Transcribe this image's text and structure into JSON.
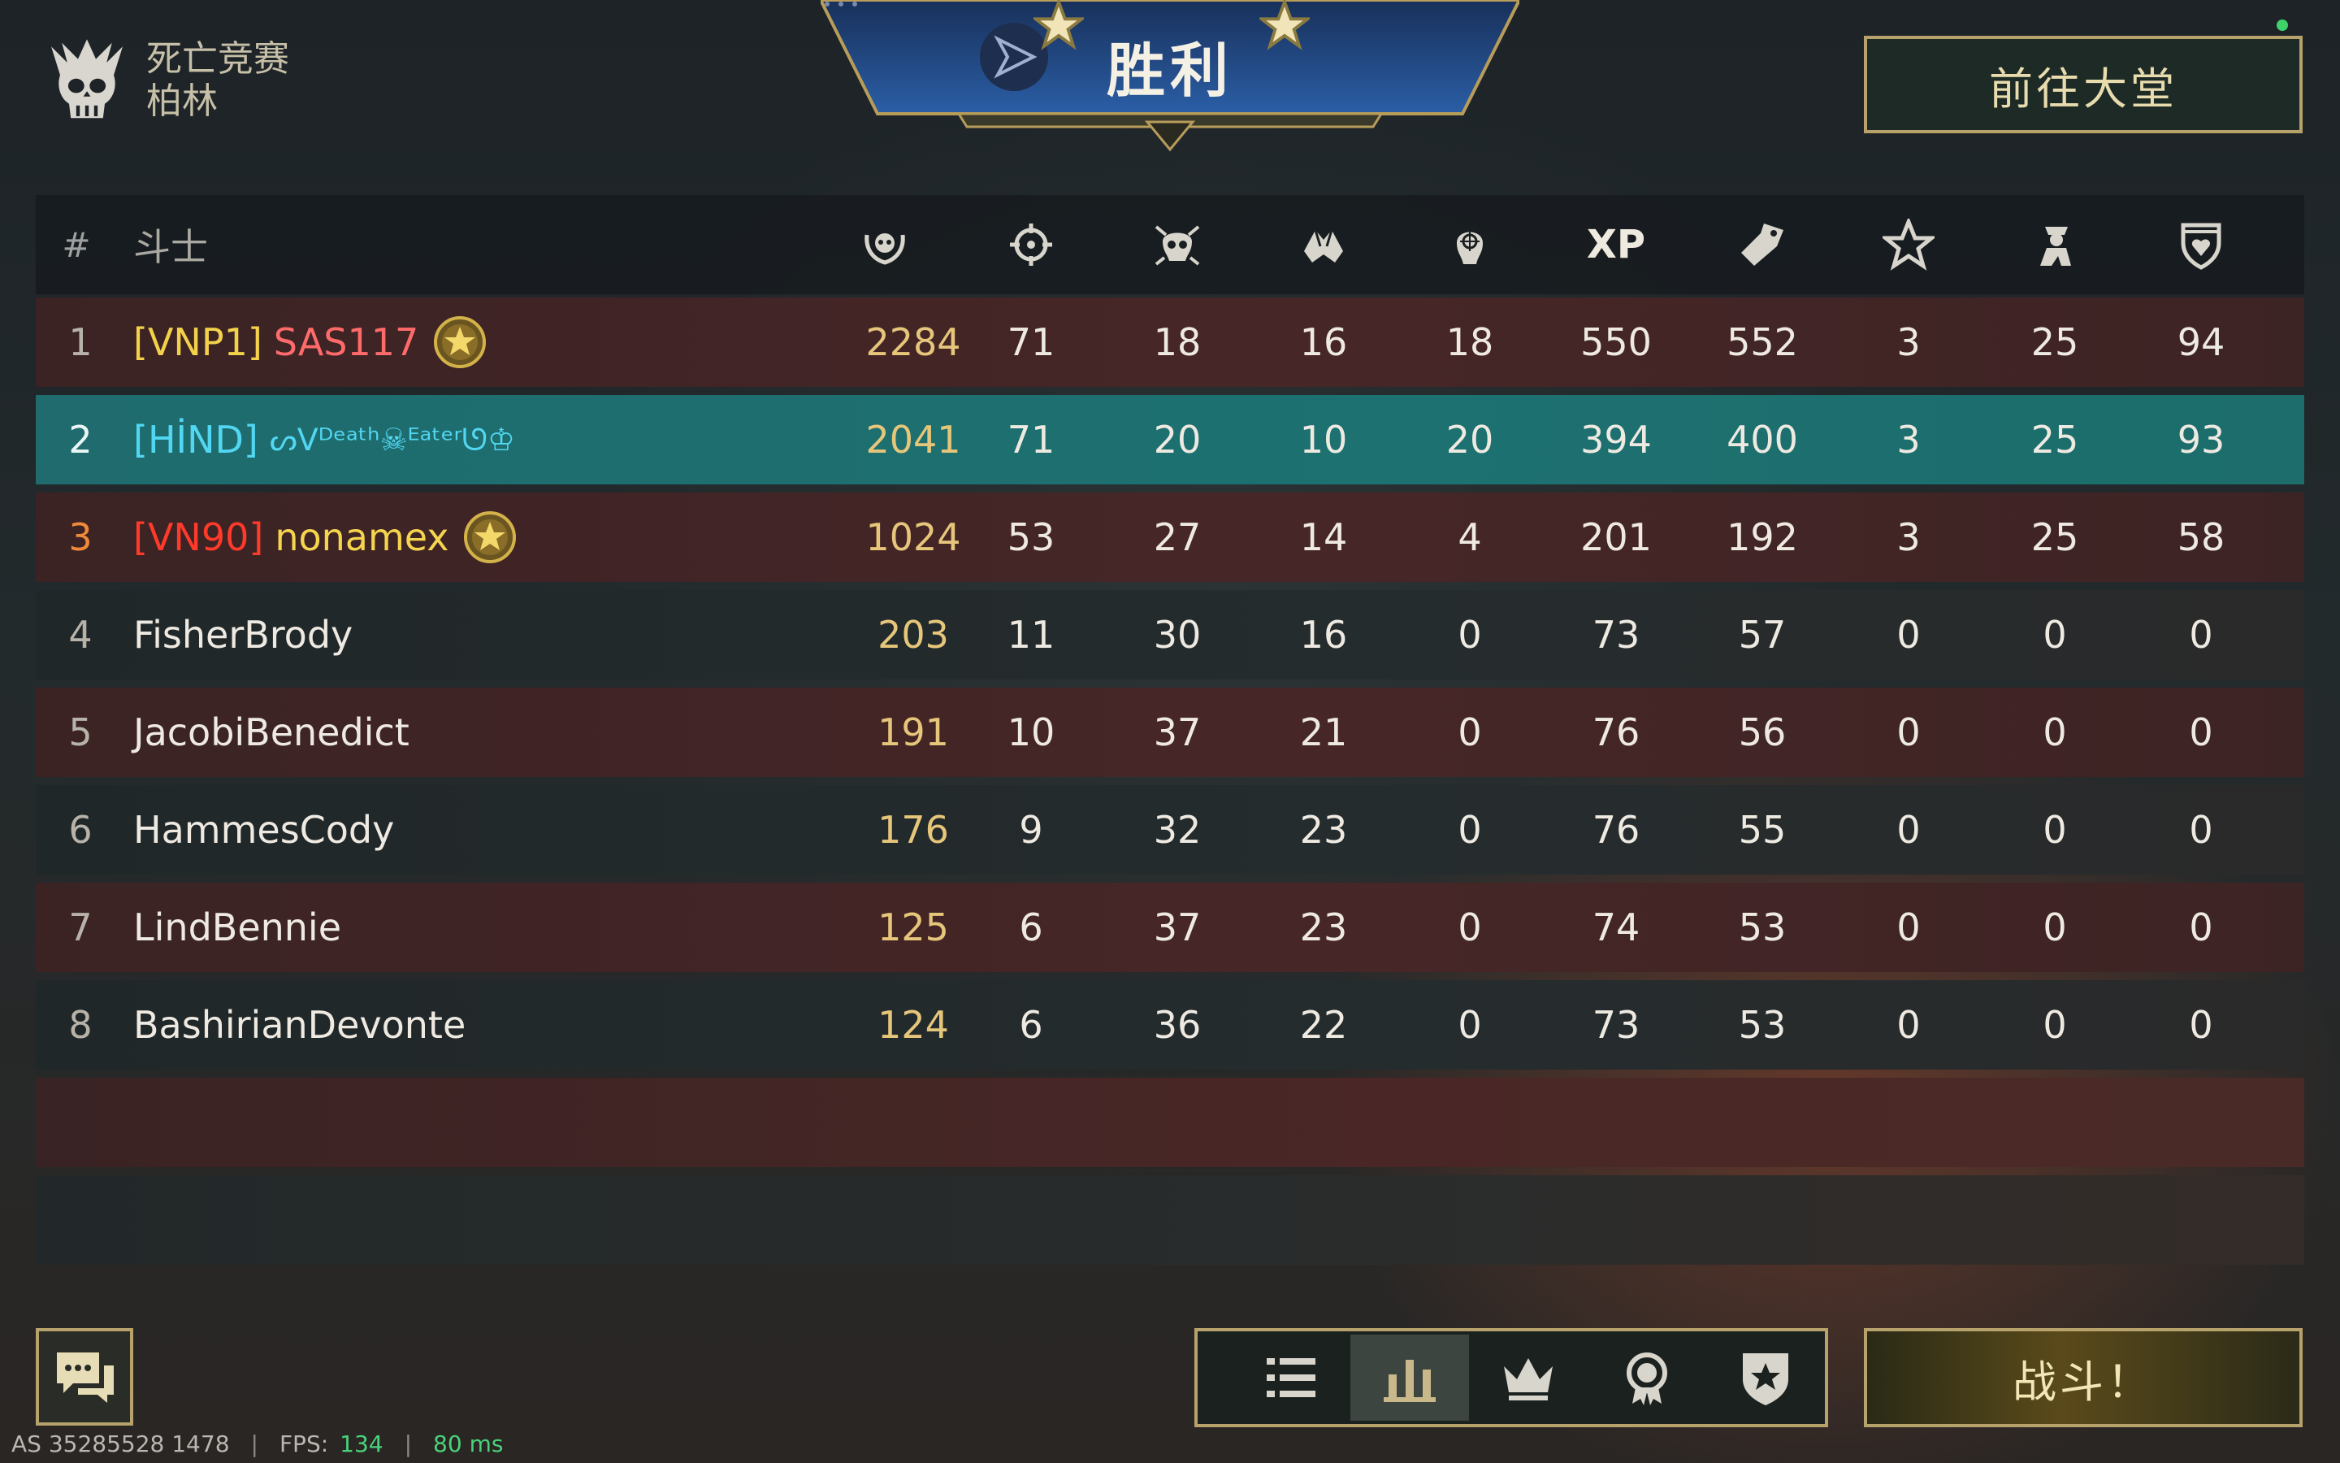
{
  "mode": {
    "name": "死亡竞赛",
    "map": "柏林"
  },
  "banner": {
    "title": "胜利"
  },
  "buttons": {
    "lobby": "前往大堂",
    "fight": "战斗！"
  },
  "table": {
    "rank_header": "#",
    "name_header": "斗士",
    "columns": [
      {
        "icon": "score-wreath-icon"
      },
      {
        "icon": "crosshair-icon"
      },
      {
        "icon": "deaths-skull-icon"
      },
      {
        "icon": "assists-hands-icon"
      },
      {
        "icon": "headshot-icon"
      },
      {
        "label": "XP"
      },
      {
        "icon": "tag-icon"
      },
      {
        "icon": "star-icon"
      },
      {
        "icon": "soldier-icon"
      },
      {
        "icon": "shield-heart-icon"
      }
    ],
    "rows": [
      {
        "rank": "1",
        "clan": "[VNP1]",
        "name": "SAS117",
        "medal": true,
        "stats": [
          "2284",
          "71",
          "18",
          "16",
          "18",
          "550",
          "552",
          "3",
          "25",
          "94"
        ]
      },
      {
        "rank": "2",
        "clan": "[HİND]",
        "name": "ᔕᐯᴰᵉᵃᵗʰ☠ᴱᵃᵗᵉʳᘎ♔",
        "medal": false,
        "stats": [
          "2041",
          "71",
          "20",
          "10",
          "20",
          "394",
          "400",
          "3",
          "25",
          "93"
        ]
      },
      {
        "rank": "3",
        "clan": "[VN90]",
        "name": "nonamex",
        "medal": true,
        "stats": [
          "1024",
          "53",
          "27",
          "14",
          "4",
          "201",
          "192",
          "3",
          "25",
          "58"
        ]
      },
      {
        "rank": "4",
        "clan": "",
        "name": "FisherBrody",
        "medal": false,
        "stats": [
          "203",
          "11",
          "30",
          "16",
          "0",
          "73",
          "57",
          "0",
          "0",
          "0"
        ]
      },
      {
        "rank": "5",
        "clan": "",
        "name": "JacobiBenedict",
        "medal": false,
        "stats": [
          "191",
          "10",
          "37",
          "21",
          "0",
          "76",
          "56",
          "0",
          "0",
          "0"
        ]
      },
      {
        "rank": "6",
        "clan": "",
        "name": "HammesCody",
        "medal": false,
        "stats": [
          "176",
          "9",
          "32",
          "23",
          "0",
          "76",
          "55",
          "0",
          "0",
          "0"
        ]
      },
      {
        "rank": "7",
        "clan": "",
        "name": "LindBennie",
        "medal": false,
        "stats": [
          "125",
          "6",
          "37",
          "23",
          "0",
          "74",
          "53",
          "0",
          "0",
          "0"
        ]
      },
      {
        "rank": "8",
        "clan": "",
        "name": "BashirianDevonte",
        "medal": false,
        "stats": [
          "124",
          "6",
          "36",
          "22",
          "0",
          "73",
          "53",
          "0",
          "0",
          "0"
        ]
      }
    ]
  },
  "tabs": [
    {
      "icon": "list-icon",
      "active": false
    },
    {
      "icon": "bar-chart-icon",
      "active": true
    },
    {
      "icon": "crown-icon",
      "active": false
    },
    {
      "icon": "medal-icon",
      "active": false
    },
    {
      "icon": "shield-star-icon",
      "active": false
    }
  ],
  "footer": {
    "server": "AS 35285528 1478",
    "fps_label": "FPS:",
    "fps": "134",
    "ping": "80 ms"
  },
  "colors": {
    "gold_border": "#b6a26a",
    "score": "#e6c67a",
    "highlight_row": "#1d7170",
    "ping_green": "#49d27a"
  }
}
